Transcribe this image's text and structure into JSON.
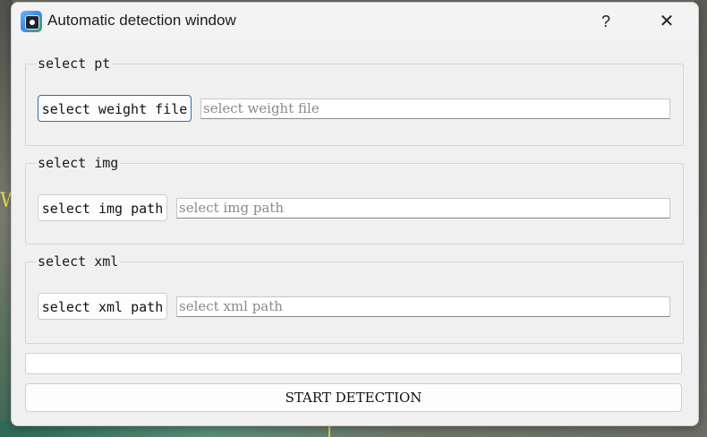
{
  "window": {
    "title": "Automatic detection window",
    "help_label": "?",
    "close_label": "✕"
  },
  "groups": [
    {
      "legend": "select pt",
      "button_label": "select weight file",
      "input_placeholder": "select weight file",
      "input_value": ""
    },
    {
      "legend": "select img",
      "button_label": "select img path",
      "input_placeholder": "select img path",
      "input_value": ""
    },
    {
      "legend": "select xml",
      "button_label": "select xml path",
      "input_placeholder": "select xml path",
      "input_value": ""
    }
  ],
  "status_bar": {
    "text": ""
  },
  "start_button": {
    "label": "START DETECTION"
  },
  "background": {
    "glyph": "W"
  },
  "colors": {
    "window_bg": "#f0f0f0",
    "focus_border": "#2a6fb5",
    "placeholder_text": "#8a8a8a"
  }
}
